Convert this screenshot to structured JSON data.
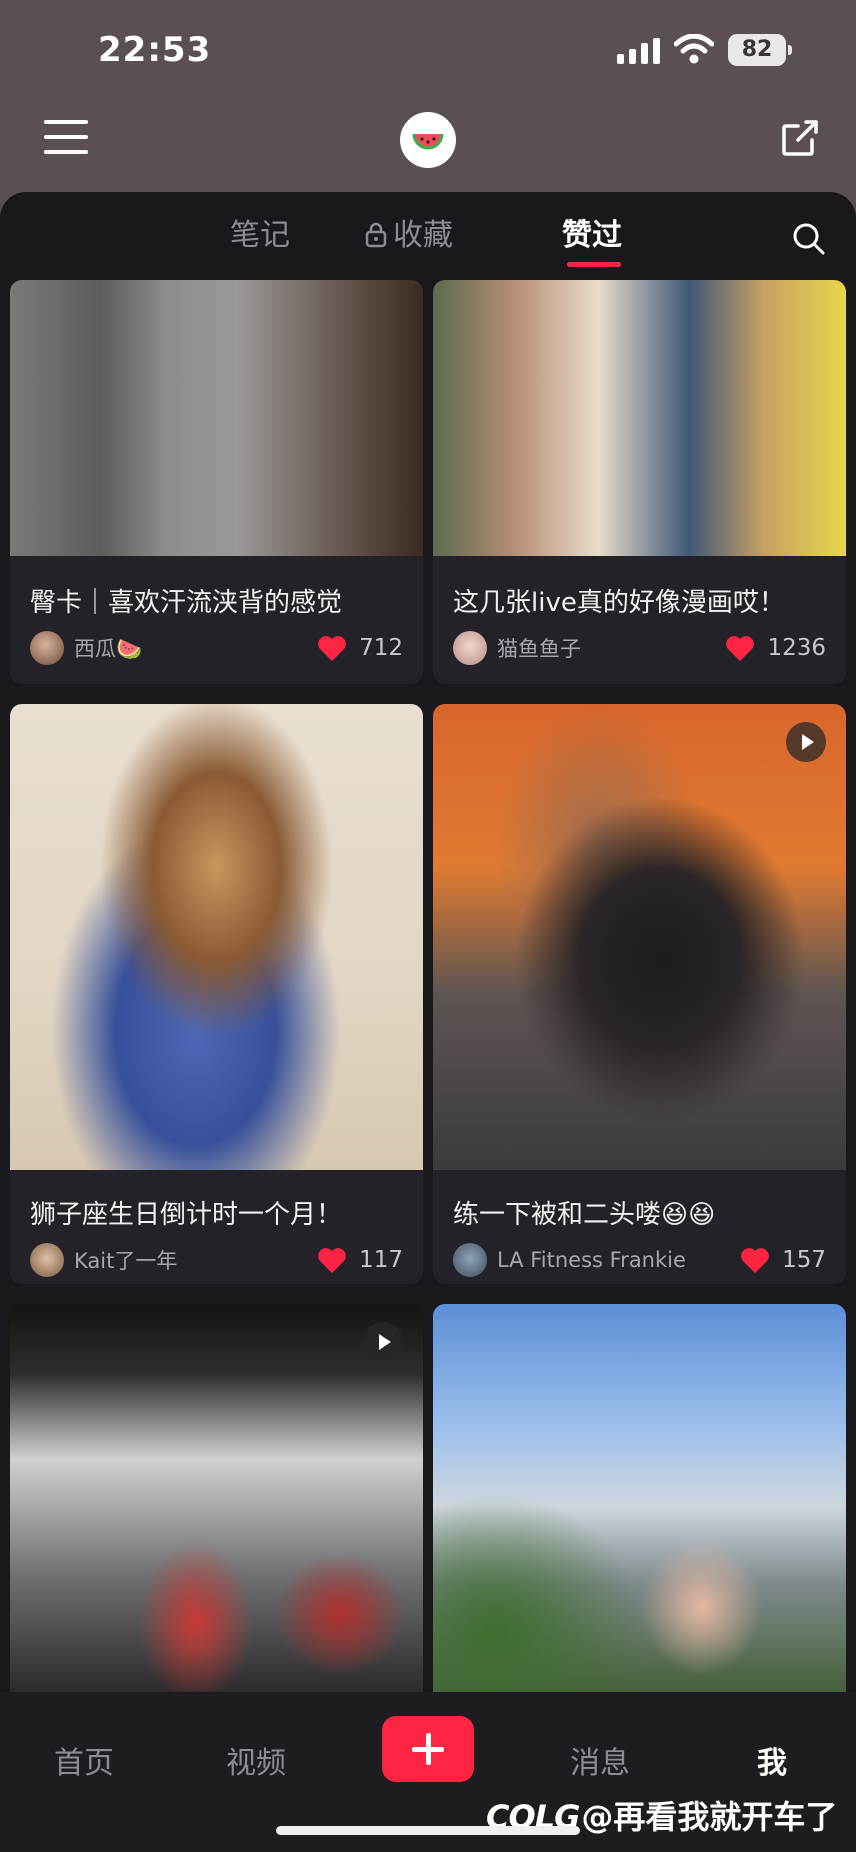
{
  "status_bar": {
    "time": "22:53",
    "battery": "82"
  },
  "tabs": {
    "notes": "笔记",
    "favorites": "收藏",
    "liked": "赞过"
  },
  "cards": [
    {
      "title": "臀卡｜喜欢汗流浃背的感觉",
      "author": "西瓜🍉",
      "likes": "712"
    },
    {
      "title": "这几张live真的好像漫画哎！",
      "author": "猫鱼鱼子",
      "likes": "1236"
    },
    {
      "title": "狮子座生日倒计时一个月！",
      "author": "Kait了一年",
      "likes": "117"
    },
    {
      "title": "练一下被和二头喽😆😆",
      "author": "LA Fitness Frankie",
      "likes": "157"
    }
  ],
  "bottom_nav": {
    "home": "首页",
    "video": "视频",
    "messages": "消息",
    "me": "我"
  },
  "watermark": {
    "brand": "COLG",
    "text": "@再看我就开车了"
  },
  "colors": {
    "accent": "#ff2442",
    "background": "#19181d",
    "card": "#232228",
    "header": "#5a4f55"
  }
}
